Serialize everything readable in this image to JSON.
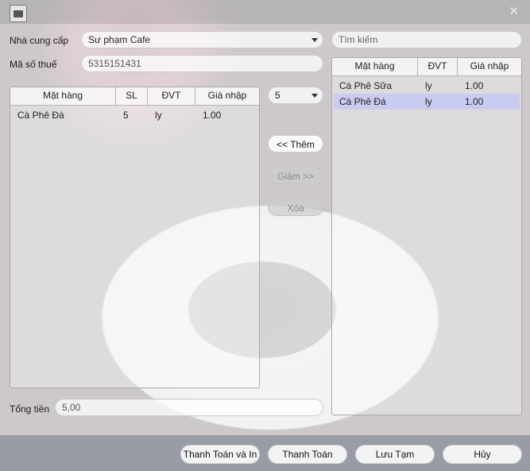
{
  "window": {
    "close_glyph": "✕"
  },
  "supplier": {
    "label": "Nhà cung cấp",
    "value": "Sư phạm Cafe"
  },
  "tax": {
    "label": "Mã số thuế",
    "value": "5315151431"
  },
  "search": {
    "placeholder": "Tìm kiếm"
  },
  "quantity_select": {
    "value": "5"
  },
  "order_table": {
    "columns": [
      "Mặt hàng",
      "SL",
      "ĐVT",
      "Giá nhập"
    ],
    "rows": [
      {
        "item": "Cà Phê Đá",
        "qty": "5",
        "unit": "ly",
        "price": "1.00"
      }
    ]
  },
  "product_table": {
    "columns": [
      "Mặt hàng",
      "ĐVT",
      "Giá nhập"
    ],
    "rows": [
      {
        "item": "Cà Phê Sữa",
        "unit": "ly",
        "price": "1.00",
        "selected": false
      },
      {
        "item": "Cà Phê Đá",
        "unit": "ly",
        "price": "1.00",
        "selected": true
      }
    ]
  },
  "actions": {
    "add": "<< Thêm",
    "reduce": "Giảm >>",
    "delete": "Xóa"
  },
  "total": {
    "label": "Tổng tiền",
    "value": "5,00"
  },
  "footer": {
    "pay_print": "Thanh Toán và In",
    "pay": "Thanh Toán",
    "save_temp": "Lưu Tạm",
    "cancel": "Hủy"
  },
  "colors": {
    "selected_row": "#c9cbf0"
  }
}
